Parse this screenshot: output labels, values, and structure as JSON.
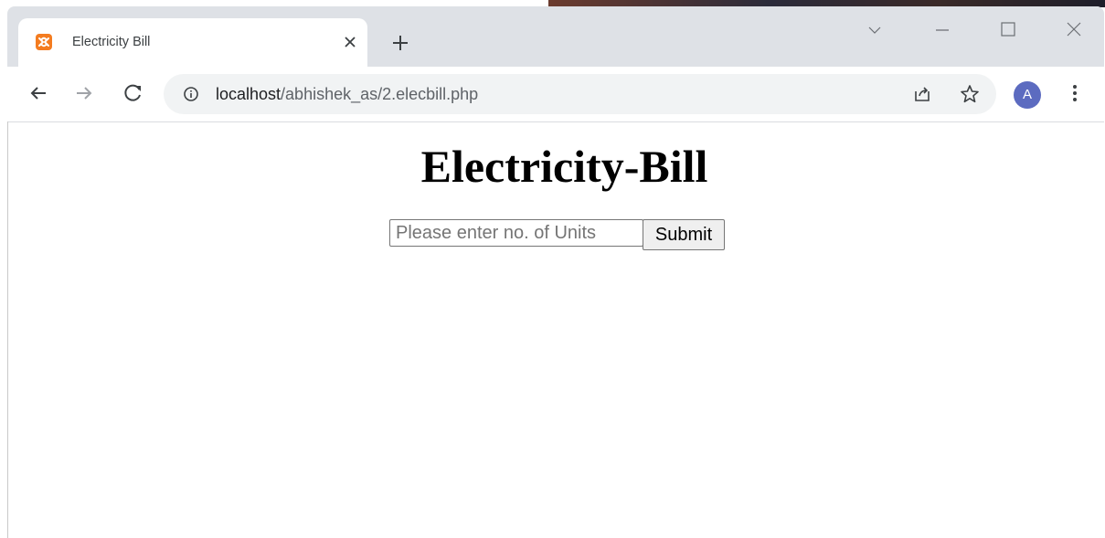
{
  "browser": {
    "tab": {
      "title": "Electricity Bill",
      "favicon": "xampp-icon"
    },
    "new_tab_icon": "plus-icon",
    "address_bar": {
      "host": "localhost",
      "path": "/abhishek_as/2.elecbill.php"
    },
    "profile_initial": "A"
  },
  "page": {
    "heading": "Electricity-Bill",
    "form": {
      "units_placeholder": "Please enter no. of Units",
      "submit_label": "Submit"
    }
  }
}
